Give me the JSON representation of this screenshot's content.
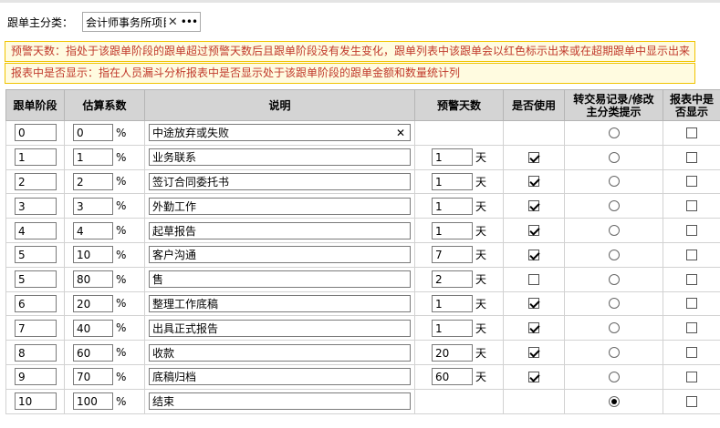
{
  "category": {
    "label": "跟单主分类：",
    "value": "会计师事务所项目",
    "clear_icon": "close-icon",
    "more_icon": "ellipsis-icon"
  },
  "notices": [
    "预警天数：指处于该跟单阶段的跟单超过预警天数后且跟单阶段没有发生变化，跟单列表中该跟单会以红色标示出来或在超期跟单中显示出来",
    "报表中是否显示：指在人员漏斗分析报表中是否显示处于该跟单阶段的跟单金额和数量统计列"
  ],
  "colors": {
    "notice_text": "#c0392b",
    "notice_bg": "#fffbe0",
    "notice_border": "#f0c400",
    "header_bg": "#d4d4d4"
  },
  "table": {
    "headers": [
      "跟单阶段",
      "估算系数",
      "说明",
      "预警天数",
      "是否使用",
      "转交易记录/修改主分类提示",
      "报表中是否显示"
    ],
    "header_lines": {
      "transfer": [
        "转交易记录/修改",
        "主分类提示"
      ],
      "report": [
        "报表中是",
        "否显示"
      ]
    },
    "percent_unit": "%",
    "day_unit": "天",
    "rows": [
      {
        "stage": "0",
        "coef": "0",
        "desc": "中途放弃或失败",
        "days": null,
        "used": null,
        "transfer": false,
        "report": false,
        "desc_clear": true
      },
      {
        "stage": "1",
        "coef": "1",
        "desc": "业务联系",
        "days": "1",
        "used": true,
        "transfer": false,
        "report": false
      },
      {
        "stage": "2",
        "coef": "2",
        "desc": "签订合同委托书",
        "days": "1",
        "used": true,
        "transfer": false,
        "report": false
      },
      {
        "stage": "3",
        "coef": "3",
        "desc": "外勤工作",
        "days": "1",
        "used": true,
        "transfer": false,
        "report": false
      },
      {
        "stage": "4",
        "coef": "4",
        "desc": "起草报告",
        "days": "1",
        "used": true,
        "transfer": false,
        "report": false
      },
      {
        "stage": "5",
        "coef": "10",
        "desc": "客户沟通",
        "days": "7",
        "used": true,
        "transfer": false,
        "report": false
      },
      {
        "stage": "5",
        "coef": "80",
        "desc": "售",
        "days": "2",
        "used": false,
        "transfer": false,
        "report": false
      },
      {
        "stage": "6",
        "coef": "20",
        "desc": "整理工作底稿",
        "days": "1",
        "used": true,
        "transfer": false,
        "report": false
      },
      {
        "stage": "7",
        "coef": "40",
        "desc": "出具正式报告",
        "days": "1",
        "used": true,
        "transfer": false,
        "report": false
      },
      {
        "stage": "8",
        "coef": "60",
        "desc": "收款",
        "days": "20",
        "used": true,
        "transfer": false,
        "report": false
      },
      {
        "stage": "9",
        "coef": "70",
        "desc": "底稿归档",
        "days": "60",
        "used": true,
        "transfer": false,
        "report": false
      },
      {
        "stage": "10",
        "coef": "100",
        "desc": "结束",
        "days": null,
        "used": null,
        "transfer": true,
        "report": false
      }
    ]
  }
}
